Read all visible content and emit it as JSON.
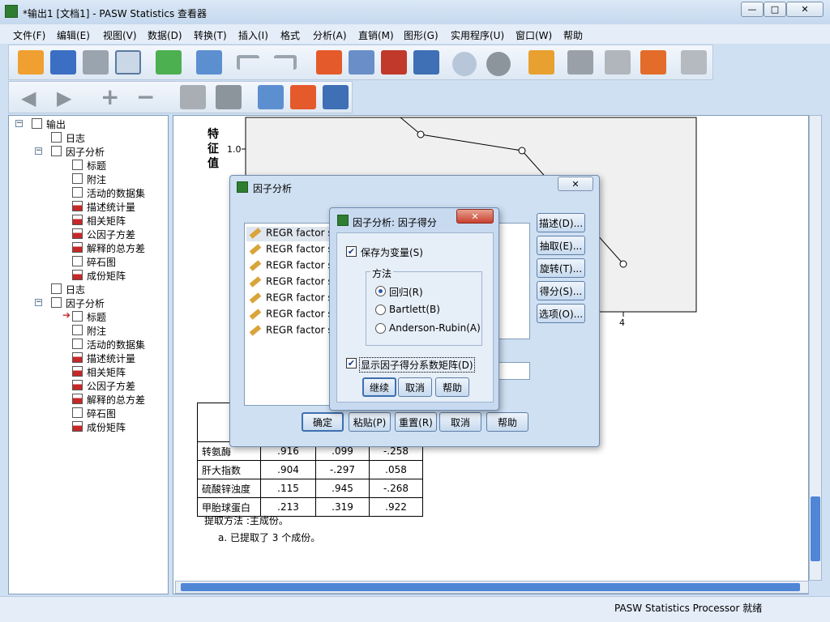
{
  "window": {
    "title": "*输出1 [文档1] - PASW Statistics 查看器",
    "min": "—",
    "max": "□",
    "close": "✕"
  },
  "menu": [
    "文件(F)",
    "编辑(E)",
    "视图(V)",
    "数据(D)",
    "转换(T)",
    "插入(I)",
    "格式",
    "分析(A)",
    "直销(M)",
    "图形(G)",
    "实用程序(U)",
    "窗口(W)",
    "帮助"
  ],
  "tree": [
    {
      "label": "输出",
      "icon": "output-book-icon"
    },
    {
      "label": "日志",
      "icon": "log-icon"
    },
    {
      "label": "因子分析",
      "icon": "procedure-book-icon"
    },
    {
      "label": "标题",
      "icon": "title-icon"
    },
    {
      "label": "附注",
      "icon": "notes-icon"
    },
    {
      "label": "活动的数据集",
      "icon": "dataset-icon"
    },
    {
      "label": "描述统计量",
      "icon": "table-icon"
    },
    {
      "label": "相关矩阵",
      "icon": "table-icon"
    },
    {
      "label": "公因子方差",
      "icon": "table-icon"
    },
    {
      "label": "解释的总方差",
      "icon": "table-icon"
    },
    {
      "label": "碎石图",
      "icon": "chart-icon"
    },
    {
      "label": "成份矩阵",
      "icon": "table-icon"
    },
    {
      "label": "日志",
      "icon": "log-icon"
    },
    {
      "label": "因子分析",
      "icon": "procedure-book-icon"
    },
    {
      "label": "标题",
      "icon": "title-icon"
    },
    {
      "label": "附注",
      "icon": "notes-icon"
    },
    {
      "label": "活动的数据集",
      "icon": "dataset-icon"
    },
    {
      "label": "描述统计量",
      "icon": "table-icon"
    },
    {
      "label": "相关矩阵",
      "icon": "table-icon"
    },
    {
      "label": "公因子方差",
      "icon": "table-icon"
    },
    {
      "label": "解释的总方差",
      "icon": "table-icon"
    },
    {
      "label": "碎石图",
      "icon": "chart-icon"
    },
    {
      "label": "成份矩阵",
      "icon": "table-icon"
    }
  ],
  "chart": {
    "ylabel": "特征值",
    "ytick": "1.0",
    "ytick_partial": "0",
    "xtick": "4"
  },
  "matrix": {
    "rows": [
      {
        "label": "转氨酶",
        "c1": ".916",
        "c2": ".099",
        "c3": "-.258"
      },
      {
        "label": "肝大指数",
        "c1": ".904",
        "c2": "-.297",
        "c3": ".058"
      },
      {
        "label": "硫酸锌浊度",
        "c1": ".115",
        "c2": ".945",
        "c3": "-.268"
      },
      {
        "label": "甲胎球蛋白",
        "c1": ".213",
        "c2": ".319",
        "c3": ".922"
      }
    ],
    "footnote1": "提取方法 :主成份。",
    "footnote2": "a. 已提取了 3 个成份。"
  },
  "dlg_main": {
    "title": "因子分析",
    "var_text": "REGR factor sc",
    "var_count": 7,
    "side_buttons": [
      "描述(D)...",
      "抽取(E)...",
      "旋转(T)...",
      "得分(S)...",
      "选项(O)..."
    ],
    "bottom_buttons": [
      "确定",
      "粘贴(P)",
      "重置(R)",
      "取消",
      "帮助"
    ]
  },
  "dlg_score": {
    "title": "因子分析: 因子得分",
    "save_as_var": "保存为变量(S)",
    "method_group": "方法",
    "methods": [
      "回归(R)",
      "Bartlett(B)",
      "Anderson-Rubin(A)"
    ],
    "selected_method": 0,
    "show_coef": "显示因子得分系数矩阵(D)",
    "buttons": [
      "继续",
      "取消",
      "帮助"
    ]
  },
  "status": "PASW Statistics Processor 就绪"
}
